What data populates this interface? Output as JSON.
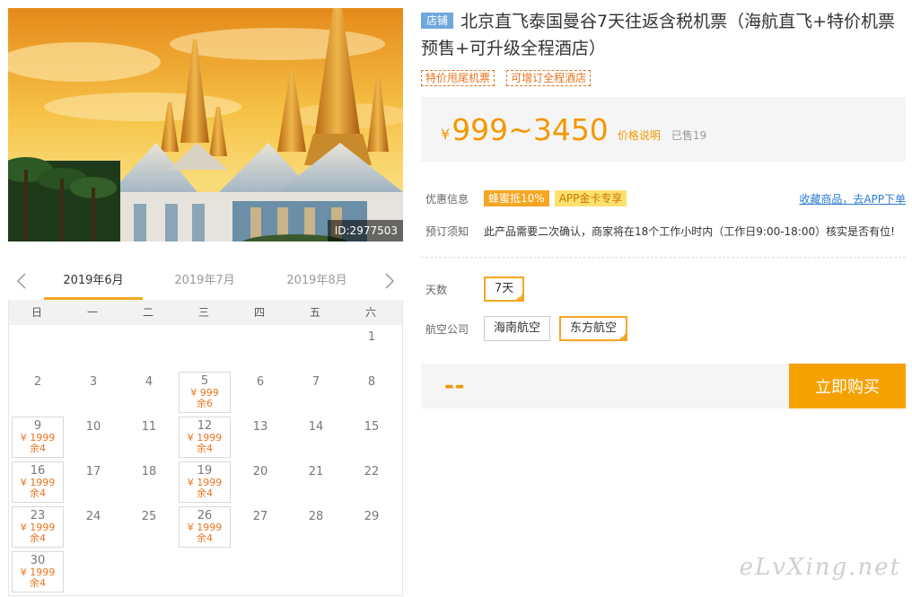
{
  "product": {
    "image_id": "ID:2977503",
    "shop_tag": "店铺",
    "title": "北京直飞泰国曼谷7天往返含税机票（海航直飞+特价机票预售+可升级全程酒店）",
    "tags": [
      "特价甩尾机票",
      "可增订全程酒店"
    ]
  },
  "price": {
    "currency": "¥",
    "range": "999~3450",
    "note": "价格说明",
    "sold": "已售19"
  },
  "promo": {
    "label": "优惠信息",
    "items": [
      "蜂蜜抵10%",
      "APP金卡专享"
    ],
    "fav_link": "收藏商品，去APP下单"
  },
  "notice": {
    "label": "预订须知",
    "text": "此产品需要二次确认，商家将在18个工作小时内（工作日9:00-18:00）核实是否有位!"
  },
  "days": {
    "label": "天数",
    "options": [
      "7天"
    ]
  },
  "airline": {
    "label": "航空公司",
    "options": [
      "海南航空",
      "东方航空"
    ]
  },
  "buy": {
    "total": "--",
    "button": "立即购买"
  },
  "calendar": {
    "months": [
      "2019年6月",
      "2019年7月",
      "2019年8月"
    ],
    "weekdays": [
      "日",
      "一",
      "二",
      "三",
      "四",
      "五",
      "六"
    ],
    "first_weekday": 6,
    "days_in_month": 30,
    "available": {
      "5": {
        "price": "¥ 999",
        "left": "余6"
      },
      "9": {
        "price": "¥ 1999",
        "left": "余4"
      },
      "12": {
        "price": "¥ 1999",
        "left": "余4"
      },
      "16": {
        "price": "¥ 1999",
        "left": "余4"
      },
      "19": {
        "price": "¥ 1999",
        "left": "余4"
      },
      "23": {
        "price": "¥ 1999",
        "left": "余4"
      },
      "26": {
        "price": "¥ 1999",
        "left": "余4"
      },
      "30": {
        "price": "¥ 1999",
        "left": "余4"
      }
    }
  },
  "watermark": "eLvXing.net",
  "colors": {
    "accent": "#f5a100",
    "price": "#f39800",
    "link": "#2b7cd3"
  }
}
